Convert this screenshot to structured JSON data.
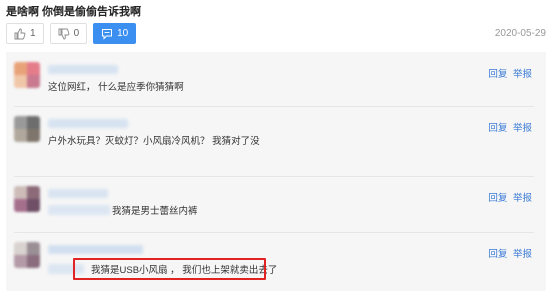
{
  "header": {
    "title": "是啥啊  你倒是偷偷告诉我啊",
    "date": "2020-05-29"
  },
  "actions": {
    "like_count": "1",
    "dislike_count": "0",
    "comment_count": "10"
  },
  "comment_ops": {
    "reply": "回复",
    "report": "举报"
  },
  "comments": [
    {
      "text": "这位网红，  什么是应季你猜猜啊"
    },
    {
      "text": "户外水玩具？灭蚊灯？小风扇冷风机？  我猜对了没"
    },
    {
      "text": "我猜是男士蕾丝内裤"
    },
    {
      "text": "我猜是USB小风扇 ，  我们也上架就卖出去了"
    }
  ],
  "colors": {
    "accent": "#3b8ff0",
    "link": "#3a7ad6",
    "highlight": "#e02424"
  }
}
